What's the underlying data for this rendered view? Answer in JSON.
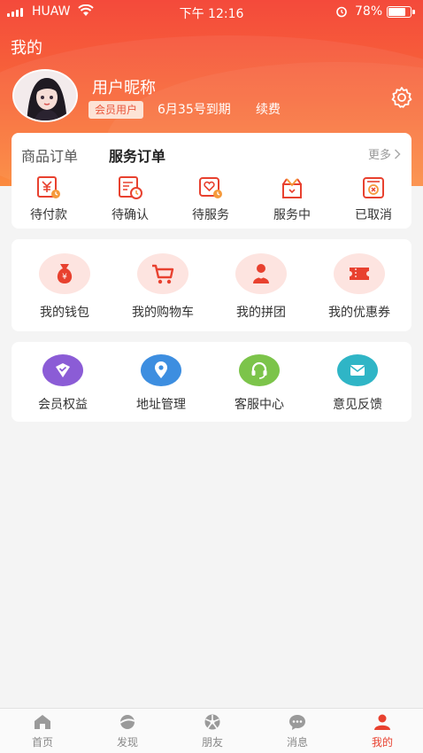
{
  "status_bar": {
    "carrier": "HUAW",
    "time": "下午 12:16",
    "battery": "78%"
  },
  "header": {
    "title": "我的",
    "user_name": "用户昵称",
    "member_badge": "会员用户",
    "expire_text": "6月35号到期",
    "renew_label": "续费"
  },
  "orders": {
    "tabs": [
      "商品订单",
      "服务订单"
    ],
    "active_tab": "服务订单",
    "more_label": "更多",
    "items": [
      {
        "label": "待付款",
        "icon": "yen-receipt-icon"
      },
      {
        "label": "待确认",
        "icon": "clock-document-icon"
      },
      {
        "label": "待服务",
        "icon": "heart-clock-icon"
      },
      {
        "label": "服务中",
        "icon": "gift-box-icon"
      },
      {
        "label": "已取消",
        "icon": "cancel-box-icon"
      }
    ]
  },
  "wallet_section": {
    "items": [
      {
        "label": "我的钱包",
        "icon": "money-bag-icon"
      },
      {
        "label": "我的购物车",
        "icon": "shopping-cart-icon"
      },
      {
        "label": "我的拼团",
        "icon": "group-icon"
      },
      {
        "label": "我的优惠券",
        "icon": "coupon-icon"
      }
    ]
  },
  "service_section": {
    "items": [
      {
        "label": "会员权益",
        "icon": "member-shield-icon"
      },
      {
        "label": "地址管理",
        "icon": "location-pin-icon"
      },
      {
        "label": "客服中心",
        "icon": "headset-icon"
      },
      {
        "label": "意见反馈",
        "icon": "feedback-mail-icon"
      }
    ]
  },
  "tab_bar": {
    "items": [
      {
        "label": "首页",
        "icon": "home-icon"
      },
      {
        "label": "发现",
        "icon": "discover-icon"
      },
      {
        "label": "朋友",
        "icon": "friends-icon"
      },
      {
        "label": "消息",
        "icon": "message-icon"
      },
      {
        "label": "我的",
        "icon": "profile-icon"
      }
    ],
    "active": "我的"
  },
  "colors": {
    "accent": "#e8412f",
    "header_gradient_top": "#f44a3b",
    "header_gradient_bottom": "#fb8a3e",
    "icon_bg_pink": "#fde4e0",
    "member_purple": "#8b5cd6",
    "address_blue": "#3d8ee0",
    "service_green": "#7cc44a",
    "feedback_teal": "#2fb5c6"
  }
}
